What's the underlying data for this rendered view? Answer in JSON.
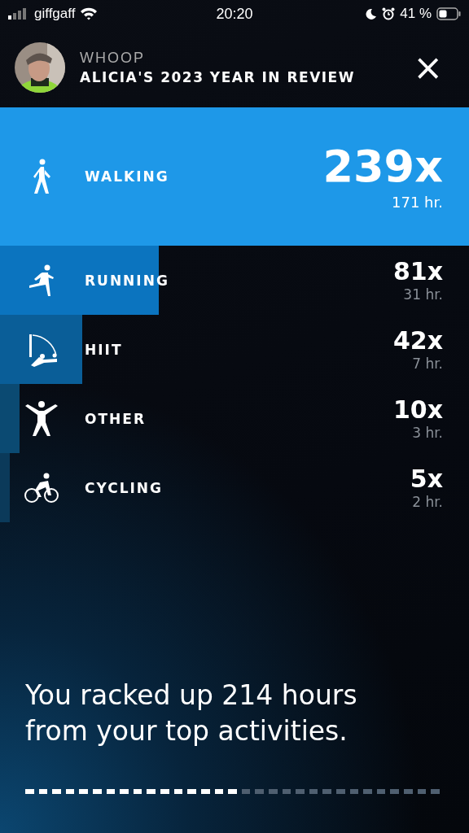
{
  "status_bar": {
    "carrier": "giffgaff",
    "time": "20:20",
    "battery": "41 %"
  },
  "header": {
    "brand": "WHOOP",
    "title": "ALICIA'S 2023 YEAR IN REVIEW",
    "close": "×"
  },
  "activities": [
    {
      "kind": "walking",
      "label": "WALKING",
      "count": "239x",
      "hours": "171 hr.",
      "color": "#1e98e8"
    },
    {
      "kind": "running",
      "label": "RUNNING",
      "count": "81x",
      "hours": "31 hr.",
      "color": "#0b74bf"
    },
    {
      "kind": "hiit",
      "label": "HIIT",
      "count": "42x",
      "hours": "7 hr.",
      "color": "#0a5e98"
    },
    {
      "kind": "other",
      "label": "OTHER",
      "count": "10x",
      "hours": "3 hr.",
      "color": "#0b4a72"
    },
    {
      "kind": "cycling",
      "label": "CYCLING",
      "count": "5x",
      "hours": "2 hr.",
      "color": "#0b3a5a"
    }
  ],
  "summary": "You racked up 214 hours from your top activities.",
  "story_progress": {
    "level": 0.516
  }
}
